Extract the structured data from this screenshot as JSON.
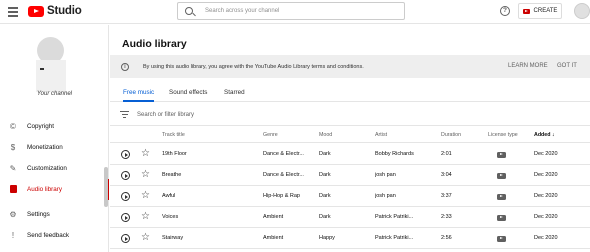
{
  "app": {
    "logo_text": "Studio"
  },
  "header": {
    "search_placeholder": "Search across your channel",
    "help_glyph": "?",
    "create_label": "CREATE"
  },
  "sidebar": {
    "channel_name": "Your channel",
    "items": [
      {
        "label": "Copyright",
        "icon": "copyright-icon",
        "glyph": "©"
      },
      {
        "label": "Monetization",
        "icon": "dollar-icon",
        "glyph": "$"
      },
      {
        "label": "Customization",
        "icon": "wand-icon",
        "glyph": "✎"
      },
      {
        "label": "Audio library",
        "icon": "audio-library-icon",
        "glyph": ""
      },
      {
        "label": "Settings",
        "icon": "gear-icon",
        "glyph": "⚙"
      },
      {
        "label": "Send feedback",
        "icon": "feedback-icon",
        "glyph": "!"
      }
    ],
    "active_index": 3
  },
  "page": {
    "title": "Audio library",
    "banner": {
      "info_glyph": "i",
      "text": "By using this audio library, you agree with the YouTube Audio Library terms and conditions.",
      "learn_more": "LEARN MORE",
      "got_it": "GOT IT"
    },
    "tabs": [
      "Free music",
      "Sound effects",
      "Starred"
    ],
    "active_tab": 0,
    "filter_placeholder": "Search or filter library"
  },
  "table": {
    "headers": {
      "track_title": "Track title",
      "genre": "Genre",
      "mood": "Mood",
      "artist": "Artist",
      "duration": "Duration",
      "license": "License type",
      "added": "Added"
    },
    "sort_glyph": "↓",
    "rows": [
      {
        "title": "19th Floor",
        "genre": "Dance & Electr...",
        "mood": "Dark",
        "artist": "Bobby Richards",
        "duration": "2:01",
        "added": "Dec 2020"
      },
      {
        "title": "Breathe",
        "genre": "Dance & Electr...",
        "mood": "Dark",
        "artist": "josh pan",
        "duration": "3:04",
        "added": "Dec 2020"
      },
      {
        "title": "Awful",
        "genre": "Hip-Hop & Rap",
        "mood": "Dark",
        "artist": "josh pan",
        "duration": "3:37",
        "added": "Dec 2020"
      },
      {
        "title": "Voices",
        "genre": "Ambient",
        "mood": "Dark",
        "artist": "Patrick Patriki...",
        "duration": "2:33",
        "added": "Dec 2020"
      },
      {
        "title": "Stairway",
        "genre": "Ambient",
        "mood": "Happy",
        "artist": "Patrick Patriki...",
        "duration": "2:56",
        "added": "Dec 2020"
      }
    ]
  },
  "colors": {
    "accent": "#065fd4",
    "brand_red": "#ff0000",
    "active_red": "#cc0000"
  }
}
